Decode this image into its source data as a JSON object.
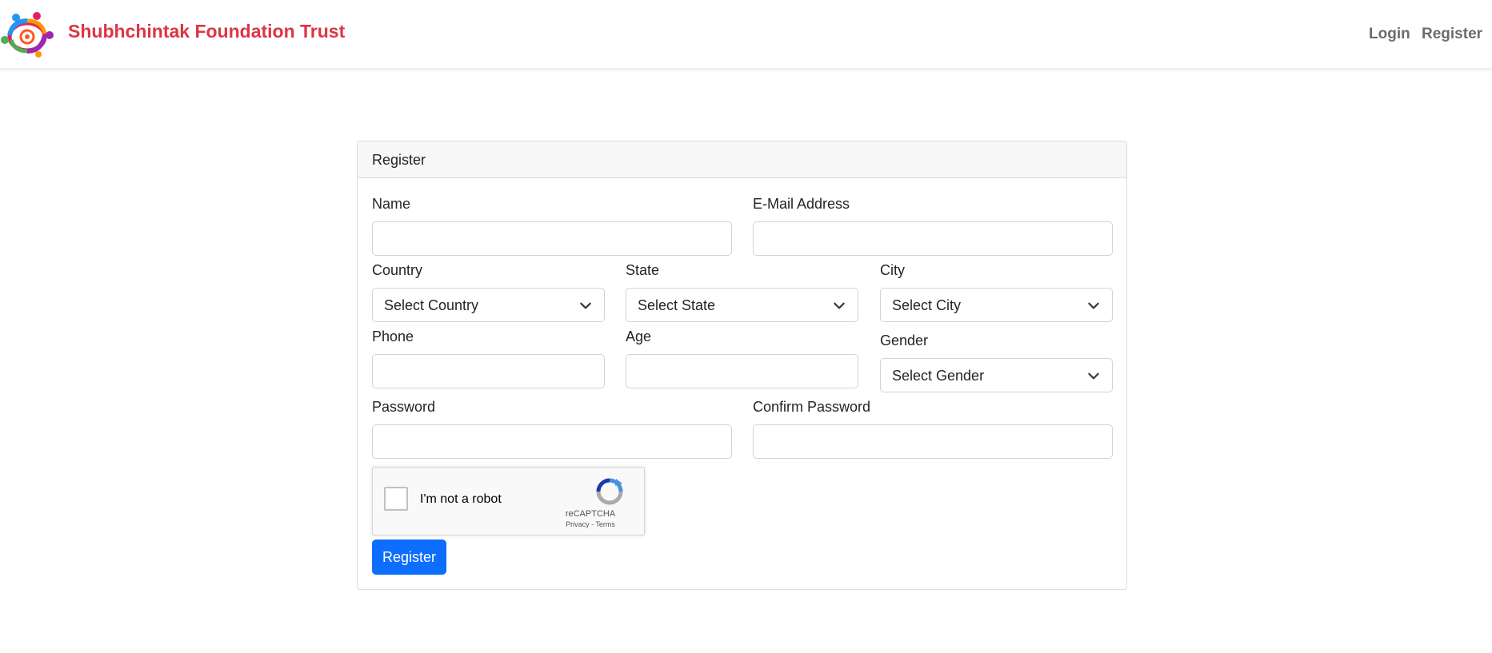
{
  "navbar": {
    "brand": "Shubhchintak Foundation Trust",
    "logo": "foundation-logo",
    "links": {
      "login": "Login",
      "register": "Register"
    }
  },
  "colors": {
    "brand": "#dc3545",
    "primary": "#0d6efd",
    "nav_link": "#6c6c6c"
  },
  "form": {
    "header": "Register",
    "name_label": "Name",
    "email_label": "E-Mail Address",
    "country_label": "Country",
    "country_selected": "Select Country",
    "state_label": "State",
    "state_selected": "Select State",
    "city_label": "City",
    "city_selected": "Select City",
    "phone_label": "Phone",
    "age_label": "Age",
    "gender_label": "Gender",
    "gender_selected": "Select Gender",
    "password_label": "Password",
    "confirm_password_label": "Confirm Password",
    "recaptcha": {
      "text": "I'm not a robot",
      "brand": "reCAPTCHA",
      "links": "Privacy - Terms"
    },
    "submit_label": "Register"
  }
}
